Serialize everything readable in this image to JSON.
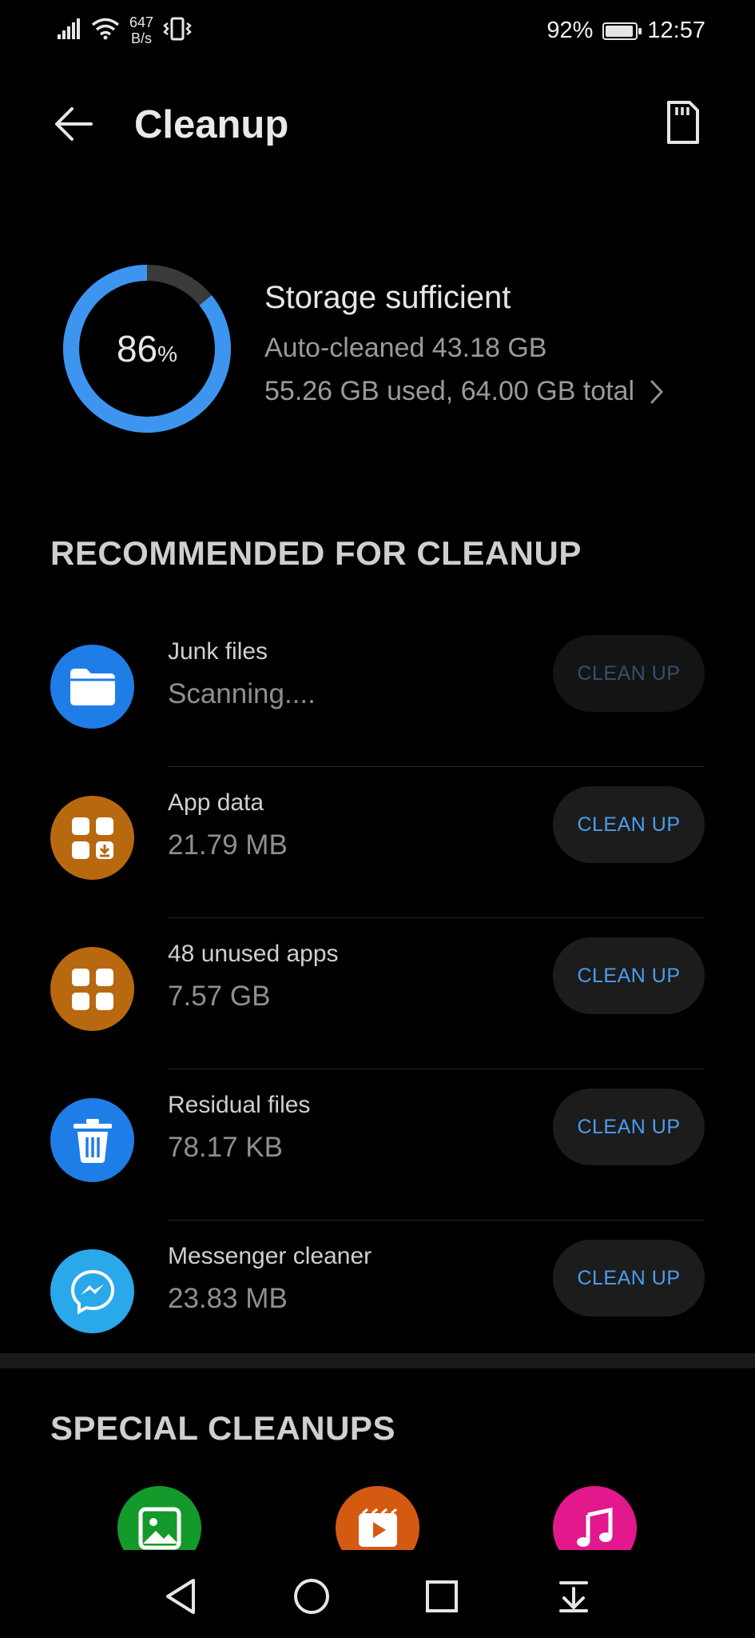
{
  "status_bar": {
    "net_speed_value": "647",
    "net_speed_unit": "B/s",
    "battery": "92%",
    "battery_level": 0.92,
    "time": "12:57"
  },
  "header": {
    "title": "Cleanup"
  },
  "storage": {
    "percent_value": "86",
    "percent_sign": "%",
    "percent_used": 86,
    "status": "Storage sufficient",
    "auto_cleaned": "Auto-cleaned 43.18 GB",
    "usage": "55.26 GB used, 64.00 GB total",
    "colors": {
      "ring": "#3d95f0",
      "track": "#3a3a3a"
    }
  },
  "recommended": {
    "heading": "RECOMMENDED FOR CLEANUP",
    "items": [
      {
        "title": "Junk files",
        "subtitle": "Scanning....",
        "button": "CLEAN UP",
        "icon": "folder-icon",
        "color": "#1f7de8"
      },
      {
        "title": "App data",
        "subtitle": "21.79 MB",
        "button": "CLEAN UP",
        "icon": "app-data-icon",
        "color": "#b8690f"
      },
      {
        "title": "48 unused apps",
        "subtitle": "7.57 GB",
        "button": "CLEAN UP",
        "icon": "apps-grid-icon",
        "color": "#b8690f"
      },
      {
        "title": "Residual files",
        "subtitle": "78.17 KB",
        "button": "CLEAN UP",
        "icon": "trash-icon",
        "color": "#1f7de8"
      },
      {
        "title": "Messenger cleaner",
        "subtitle": "23.83 MB",
        "button": "CLEAN UP",
        "icon": "messenger-icon",
        "color": "#2aa9ea"
      }
    ]
  },
  "special": {
    "heading": "SPECIAL CLEANUPS",
    "items": [
      {
        "icon": "image-icon",
        "color": "#139a2b"
      },
      {
        "icon": "video-icon",
        "color": "#d45a12"
      },
      {
        "icon": "music-icon",
        "color": "#e2188c"
      }
    ]
  }
}
